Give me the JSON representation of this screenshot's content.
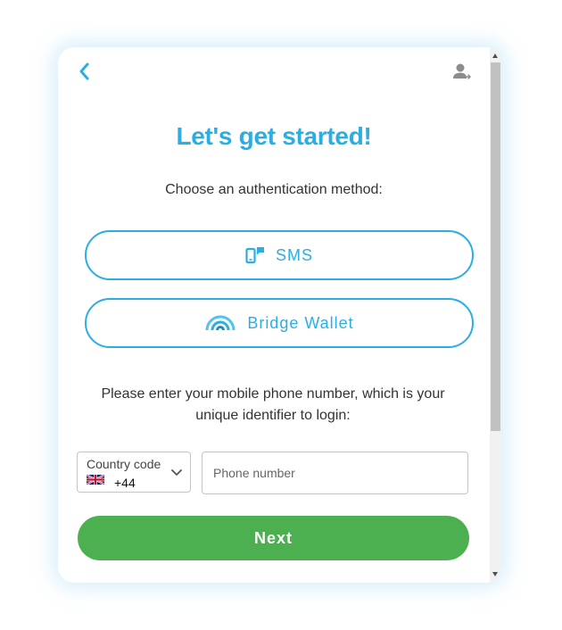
{
  "header": {
    "back_icon": "chevron-left-icon",
    "account_icon": "user-account-icon"
  },
  "title": "Let's get started!",
  "subtitle": "Choose an authentication method:",
  "methods": [
    {
      "label": "SMS",
      "icon": "sms-phone-icon"
    },
    {
      "label": "Bridge Wallet",
      "icon": "bridge-wallet-icon"
    }
  ],
  "instructions": "Please enter your mobile phone number, which is your unique identifier to login:",
  "country": {
    "label": "Country code",
    "flag": "uk-flag-icon",
    "value": "+44"
  },
  "phone": {
    "placeholder": "Phone number",
    "value": ""
  },
  "next_label": "Next",
  "colors": {
    "accent": "#2aaee4",
    "primary_button": "#4caf50",
    "text": "#333333",
    "border": "#c4c4c4"
  }
}
